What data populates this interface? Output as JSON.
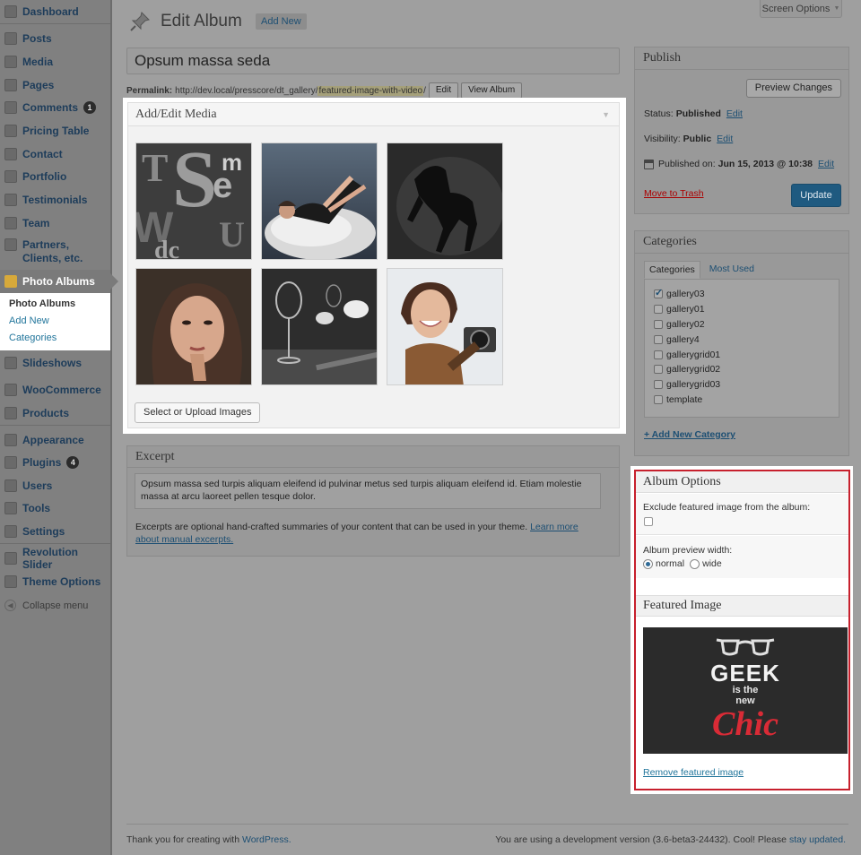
{
  "screen_options": "Screen Options",
  "menu": {
    "items": [
      {
        "label": "Dashboard",
        "icon": "dashboard-icon"
      },
      {
        "label": "Posts",
        "icon": "posts-icon"
      },
      {
        "label": "Media",
        "icon": "media-icon"
      },
      {
        "label": "Pages",
        "icon": "pages-icon"
      },
      {
        "label": "Comments",
        "icon": "comments-icon",
        "badge": "1"
      },
      {
        "label": "Pricing Table",
        "icon": "pricing-table-icon"
      },
      {
        "label": "Contact",
        "icon": "contact-icon"
      },
      {
        "label": "Portfolio",
        "icon": "portfolio-icon"
      },
      {
        "label": "Testimonials",
        "icon": "testimonials-icon"
      },
      {
        "label": "Team",
        "icon": "team-icon"
      },
      {
        "label": "Partners, Clients, etc.",
        "icon": "partners-icon"
      },
      {
        "label": "Photo Albums",
        "icon": "photo-albums-icon"
      },
      {
        "label": "Slideshows",
        "icon": "slideshows-icon"
      },
      {
        "label": "WooCommerce",
        "icon": "woocommerce-icon"
      },
      {
        "label": "Products",
        "icon": "products-icon"
      },
      {
        "label": "Appearance",
        "icon": "appearance-icon"
      },
      {
        "label": "Plugins",
        "icon": "plugins-icon",
        "badge": "4"
      },
      {
        "label": "Users",
        "icon": "users-icon"
      },
      {
        "label": "Tools",
        "icon": "tools-icon"
      },
      {
        "label": "Settings",
        "icon": "settings-icon"
      },
      {
        "label": "Revolution Slider",
        "icon": "revolution-slider-icon"
      },
      {
        "label": "Theme Options",
        "icon": "theme-options-icon"
      }
    ],
    "submenu": [
      "Photo Albums",
      "Add New",
      "Categories"
    ],
    "collapse": "Collapse menu"
  },
  "header": {
    "title": "Edit Album",
    "add_new": "Add New"
  },
  "post_title": "Opsum massa seda",
  "permalink": {
    "label": "Permalink:",
    "base": "http://dev.local/presscore/dt_gallery/",
    "slug": "featured-image-with-video",
    "end": "/",
    "edit": "Edit",
    "view": "View Album"
  },
  "media_box": {
    "title": "Add/Edit Media",
    "button": "Select or Upload Images",
    "images": [
      "typography-letters",
      "woman-on-white-chair",
      "black-horse",
      "woman-portrait",
      "wine-glasses",
      "smiling-woman-with-camera"
    ]
  },
  "excerpt": {
    "title": "Excerpt",
    "text": "Opsum massa sed turpis aliquam eleifend id pulvinar metus sed turpis aliquam eleifend id. Etiam molestie massa at arcu laoreet pellen tesque dolor.",
    "help": "Excerpts are optional hand-crafted summaries of your content that can be used in your theme.",
    "link": "Learn more about manual excerpts."
  },
  "publish": {
    "title": "Publish",
    "preview": "Preview Changes",
    "status_label": "Status:",
    "status_value": "Published",
    "visibility_label": "Visibility:",
    "visibility_value": "Public",
    "published_label": "Published on:",
    "published_value": "Jun 15, 2013 @ 10:38",
    "edit": "Edit",
    "trash": "Move to Trash",
    "update": "Update"
  },
  "categories": {
    "title": "Categories",
    "tab_all": "Categories",
    "tab_used": "Most Used",
    "items": [
      {
        "label": "gallery03",
        "checked": true
      },
      {
        "label": "gallery01",
        "checked": false
      },
      {
        "label": "gallery02",
        "checked": false
      },
      {
        "label": "gallery4",
        "checked": false
      },
      {
        "label": "gallerygrid01",
        "checked": false
      },
      {
        "label": "gallerygrid02",
        "checked": false
      },
      {
        "label": "gallerygrid03",
        "checked": false
      },
      {
        "label": "template",
        "checked": false
      }
    ],
    "add_new": "+ Add New Category"
  },
  "album_options": {
    "title": "Album Options",
    "exclude_label": "Exclude featured image from the album:",
    "width_label": "Album preview width:",
    "opt_normal": "normal",
    "opt_wide": "wide",
    "selected": "normal"
  },
  "featured": {
    "title": "Featured Image",
    "line1": "GEEK",
    "line2": "is the",
    "line3": "new",
    "line4": "Chic",
    "remove": "Remove featured image"
  },
  "footer": {
    "left_text": "Thank you for creating with",
    "left_link": "WordPress.",
    "right_text": "You are using a development version (3.6-beta3-24432). Cool! Please",
    "right_link": "stay updated."
  },
  "colors": {
    "update_button": "#1f5a80",
    "highlight_border": "#c7202d",
    "link": "#21759b"
  }
}
